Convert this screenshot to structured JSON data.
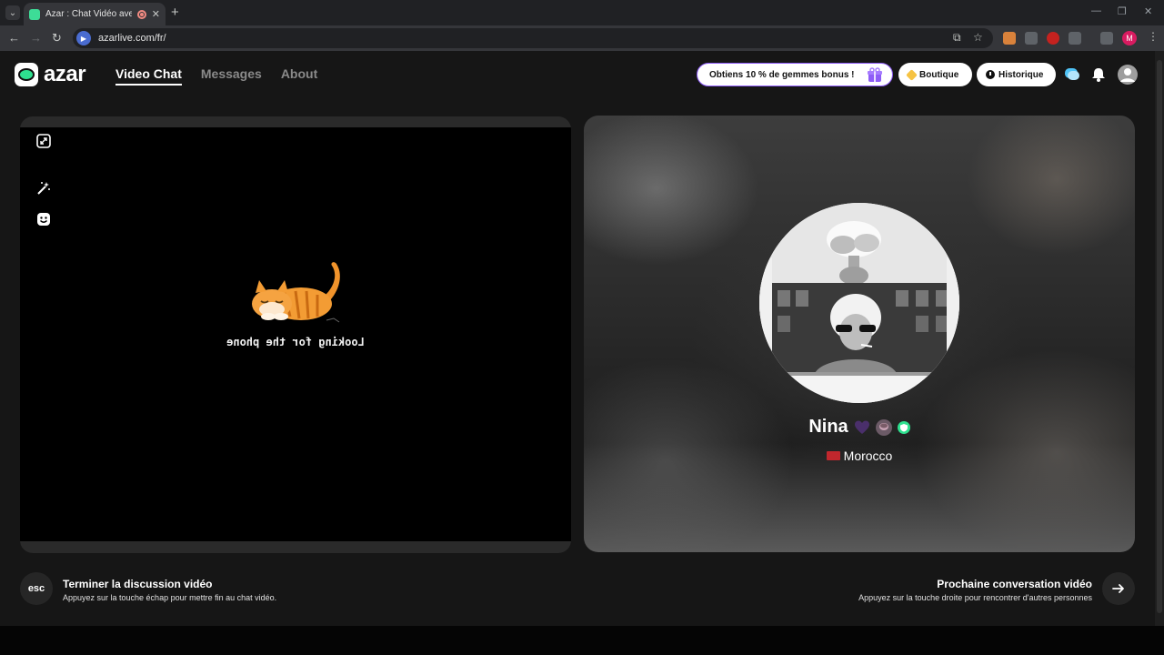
{
  "browser": {
    "tab_title": "Azar : Chat Vidéo avec de n",
    "url": "azarlive.com/fr/",
    "profile_initial": "M"
  },
  "header": {
    "logo_text": "azar",
    "nav": [
      {
        "label": "Video Chat",
        "active": true
      },
      {
        "label": "Messages",
        "active": false
      },
      {
        "label": "About",
        "active": false
      }
    ],
    "promo_label": "Obtiens 10 % de gemmes bonus !",
    "shop_label": "Boutique",
    "history_label": "Historique"
  },
  "local": {
    "status_text": "Looking for the phone"
  },
  "remote": {
    "name": "Nina",
    "country": "Morocco"
  },
  "footer": {
    "esc_key": "esc",
    "end_title": "Terminer la discussion vidéo",
    "end_sub": "Appuyez sur la touche échap pour mettre fin au chat vidéo.",
    "next_title": "Prochaine conversation vidéo",
    "next_sub": "Appuyez sur la touche droite pour rencontrer d'autres personnes"
  },
  "colors": {
    "accent_green": "#2ee08f",
    "promo_border": "#8e5cf7",
    "gem": "#f6c343",
    "flag_red": "#c1272d"
  }
}
